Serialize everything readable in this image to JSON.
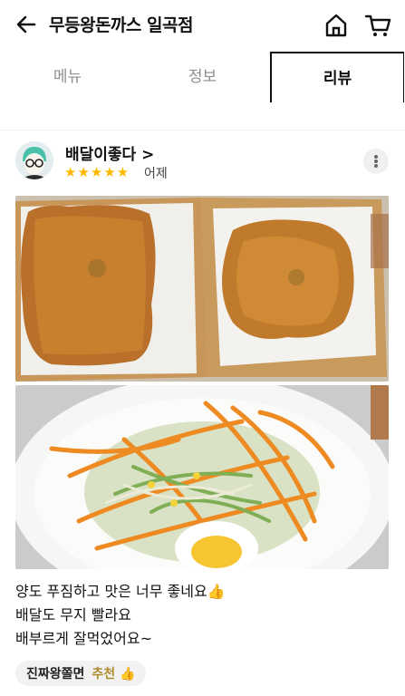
{
  "header": {
    "title": "무등왕돈까스 일곡점"
  },
  "icons": {
    "back": "arrow-left-icon",
    "home": "home-icon",
    "cart": "cart-icon",
    "more": "more-vertical-icon",
    "thumb": "thumbs-up-icon"
  },
  "tabs": [
    {
      "label": "메뉴"
    },
    {
      "label": "정보"
    },
    {
      "label": "리뷰"
    }
  ],
  "review": {
    "author": "배달이좋다 >",
    "stars": "★★★★★",
    "rating": 5,
    "date": "어제",
    "lines": [
      "양도 푸짐하고 맛은 너무 좋네요👍",
      "배달도 무지 빨라요",
      "배부르게 잘먹었어요~"
    ],
    "tag_menu": "진짜왕쫄면",
    "tag_recommend": "추천 👍"
  },
  "colors": {
    "star": "#ffb800",
    "recommend": "#b08b2e"
  }
}
